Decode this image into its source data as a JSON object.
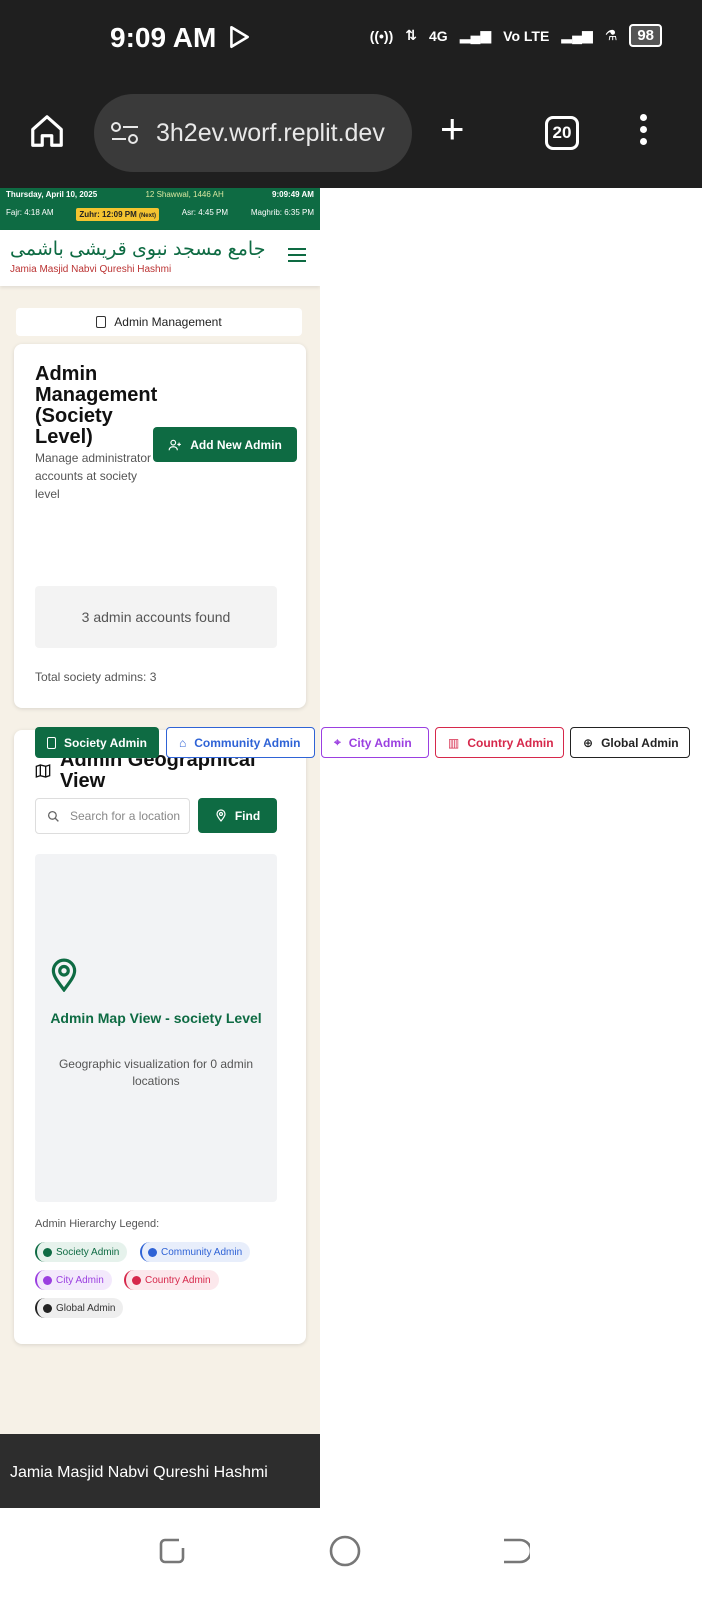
{
  "status": {
    "time": "9:09 AM",
    "net": "4G",
    "volte": "Vo LTE",
    "battery": "98"
  },
  "browser": {
    "url": "3h2ev.worf.replit.dev",
    "tabs": "20"
  },
  "site": {
    "date": "Thursday, April 10, 2025",
    "hijri": "12 Shawwal, 1446 AH",
    "clock": "9:09:49 AM",
    "fajr": "Fajr: 4:18 AM",
    "zuhr": "Zuhr: 12:09 PM",
    "zuhr_next": "(Next)",
    "asr": "Asr: 4:45 PM",
    "maghrib": "Maghrib: 6:35 PM",
    "urdu_title": "جامع مسجد نبوی قریشی باشمی",
    "english_title": "Jamia Masjid Nabvi Qureshi Hashmi"
  },
  "nav": {
    "current": "Admin Management"
  },
  "admin": {
    "title": "Admin Management (Society Level)",
    "subtitle": "Manage administrator accounts at society level",
    "add_button": "Add New Admin",
    "roles": [
      "Society Admin",
      "Community Admin",
      "City Admin",
      "Country Admin",
      "Global Admin"
    ],
    "found": "3 admin accounts found",
    "total": "Total society admins: 3"
  },
  "geo": {
    "title": "Admin Geographical View",
    "search_placeholder": "Search for a location",
    "find": "Find",
    "map_title": "Admin Map View - society Level",
    "map_sub": "Geographic visualization for 0 admin locations",
    "legend_label": "Admin Hierarchy Legend:",
    "legend": [
      "Society Admin",
      "Community Admin",
      "City Admin",
      "Country Admin",
      "Global Admin"
    ]
  },
  "footer": {
    "text": "Jamia Masjid Nabvi Qureshi Hashmi"
  },
  "colors": {
    "green": "#0e6b43",
    "blue": "#2f63d6",
    "purple": "#9b3fe0",
    "red": "#d6284b",
    "black": "#222222"
  }
}
